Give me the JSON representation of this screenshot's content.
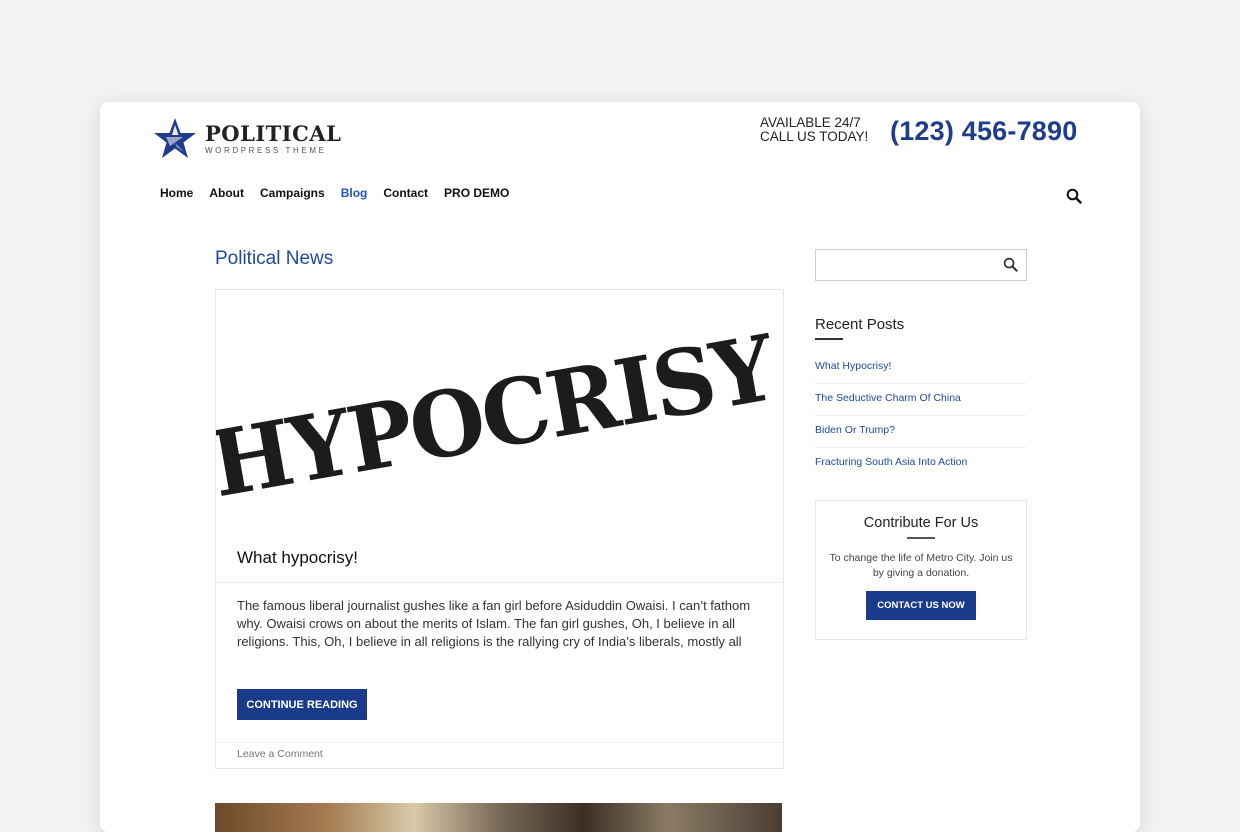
{
  "header": {
    "logo_title": "POLITICAL",
    "logo_subtitle": "WORDPRESS THEME",
    "available_line1": "AVAILABLE 24/7",
    "available_line2": "CALL US TODAY!",
    "phone": "(123) 456-7890"
  },
  "nav": {
    "items": [
      {
        "label": "Home",
        "active": false
      },
      {
        "label": "About",
        "active": false
      },
      {
        "label": "Campaigns",
        "active": false
      },
      {
        "label": "Blog",
        "active": true
      },
      {
        "label": "Contact",
        "active": false
      },
      {
        "label": "PRO DEMO",
        "active": false
      }
    ],
    "search_icon": "search-icon"
  },
  "main": {
    "section_title": "Political News",
    "post": {
      "image_text": "HYPOCRISY",
      "title": "What hypocrisy!",
      "excerpt": "The famous liberal journalist gushes like a fan girl before Asiduddin Owaisi. I can’t fathom why. Owaisi crows on about the merits of Islam. The fan girl gushes, Oh, I believe in all religions. This, Oh, I believe in all religions is the rallying cry of India’s liberals, mostly all",
      "button_label": "CONTINUE READING",
      "comment_link": "Leave a Comment"
    }
  },
  "sidebar": {
    "search": {
      "placeholder": "",
      "value": ""
    },
    "recent_posts_title": "Recent Posts",
    "recent_posts": [
      "What Hypocrisy!",
      "The Seductive Charm Of China",
      "Biden Or Trump?",
      "Fracturing South Asia Into Action"
    ],
    "contribute": {
      "title": "Contribute For Us",
      "text": "To change the life of Metro City. Join us by giving a donation.",
      "button_label": "CONTACT US NOW"
    }
  },
  "colors": {
    "brand_blue": "#1f3d8c",
    "link_blue": "#1f4aa0",
    "button_blue": "#1a3b8a"
  }
}
